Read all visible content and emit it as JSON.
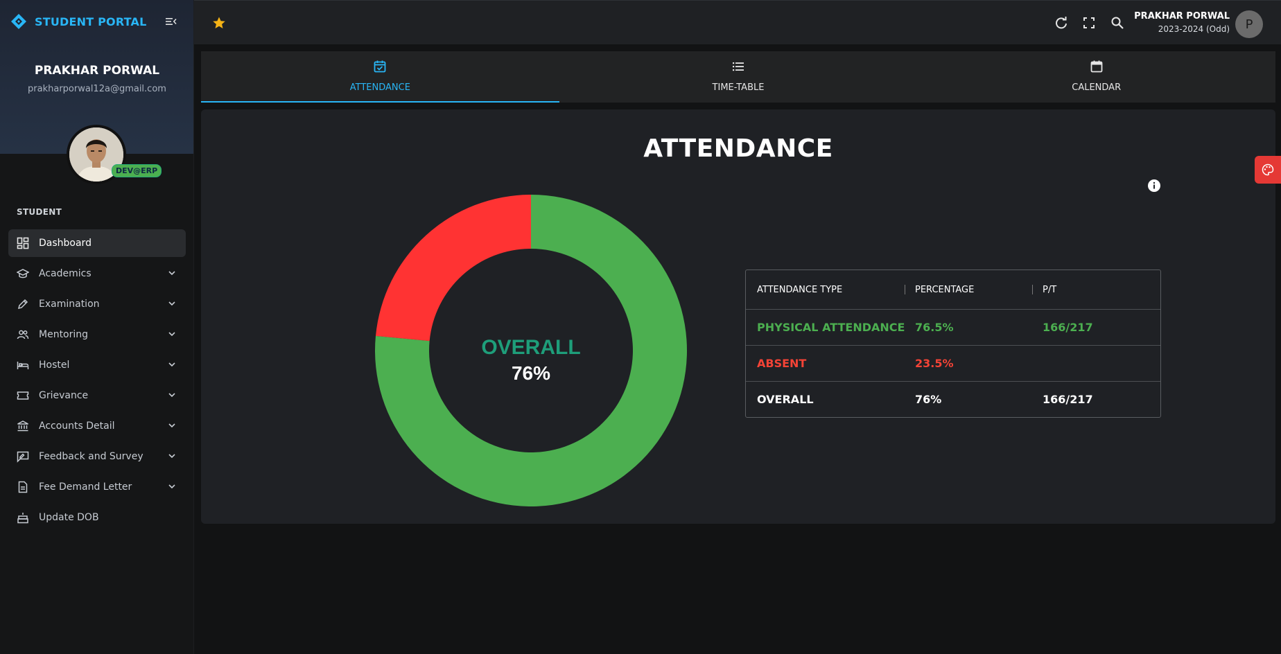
{
  "brand": {
    "name": "STUDENT PORTAL",
    "color": "#29b6f6"
  },
  "profile": {
    "name": "PRAKHAR PORWAL",
    "email": "prakharporwal12a@gmail.com",
    "badge": "DEV@ERP"
  },
  "sidebar": {
    "section": "STUDENT",
    "items": [
      {
        "label": "Dashboard",
        "icon": "dashboard-icon",
        "active": true
      },
      {
        "label": "Academics",
        "icon": "graduation-cap-icon"
      },
      {
        "label": "Examination",
        "icon": "pencil-icon"
      },
      {
        "label": "Mentoring",
        "icon": "people-icon"
      },
      {
        "label": "Hostel",
        "icon": "bed-icon"
      },
      {
        "label": "Grievance",
        "icon": "ticket-icon"
      },
      {
        "label": "Accounts Detail",
        "icon": "bank-icon"
      },
      {
        "label": "Feedback and Survey",
        "icon": "feedback-icon"
      },
      {
        "label": "Fee Demand Letter",
        "icon": "document-icon"
      },
      {
        "label": "Update DOB",
        "icon": "cake-icon"
      }
    ]
  },
  "topbar": {
    "user_name": "PRAKHAR PORWAL",
    "session": "2023-2024 (Odd)",
    "avatar_letter": "P"
  },
  "tabs": [
    {
      "label": "ATTENDANCE",
      "icon": "calendar-check-icon",
      "active": true
    },
    {
      "label": "TIME-TABLE",
      "icon": "list-icon"
    },
    {
      "label": "CALENDAR",
      "icon": "calendar-icon"
    }
  ],
  "attendance": {
    "title": "ATTENDANCE",
    "center_label": "OVERALL",
    "center_value": "76%",
    "table": {
      "headers": [
        "ATTENDANCE TYPE",
        "PERCENTAGE",
        "P/T"
      ],
      "rows": [
        {
          "type": "PHYSICAL ATTENDANCE",
          "percentage": "76.5%",
          "pt": "166/217",
          "tone": "green"
        },
        {
          "type": "ABSENT",
          "percentage": "23.5%",
          "pt": "",
          "tone": "red"
        },
        {
          "type": "OVERALL",
          "percentage": "76%",
          "pt": "166/217",
          "tone": "white"
        }
      ]
    }
  },
  "chart_data": {
    "type": "pie",
    "categories": [
      "PHYSICAL ATTENDANCE",
      "ABSENT"
    ],
    "values": [
      76.5,
      23.5
    ],
    "colors": [
      "#4caf50",
      "#ff3333"
    ],
    "donut": true
  },
  "colors": {
    "accent": "#29b6f6",
    "present": "#4caf50",
    "absent": "#f44336",
    "center_label": "#1e9e7a",
    "palette_button": "#e53935"
  }
}
